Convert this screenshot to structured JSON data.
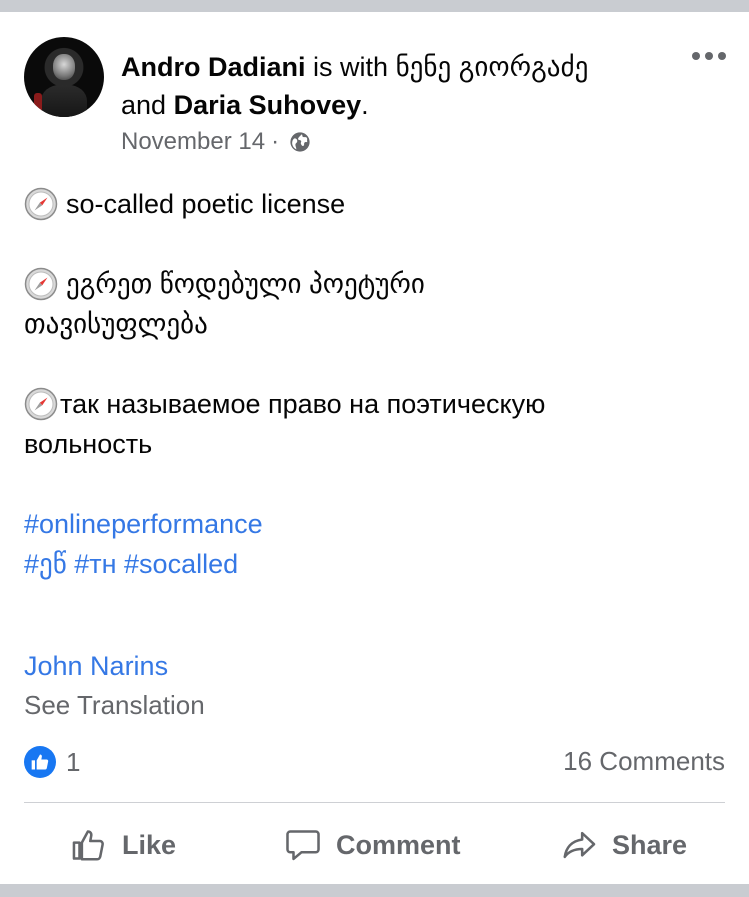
{
  "post": {
    "author": "Andro Dadiani",
    "with_text": "is with",
    "tagged_first": "ნენე გიორგაძე",
    "and_text": "and",
    "tagged_second": "Daria  Suhovey",
    "period": ".",
    "date": "November 14",
    "separator": "·",
    "privacy_icon": "globe-icon",
    "lines": {
      "en": "so-called poetic license",
      "ka_1": "ეგრეთ წოდებული პოეტური",
      "ka_2": "თავისუფლება",
      "ru_1": "так называемое право на поэтическую",
      "ru_2": "вольность"
    },
    "hashtags": {
      "h1": "#onlineperformance",
      "h2": "#ეწ",
      "h3": "#тн",
      "h4": "#socalled"
    },
    "tagged_name": "John Narins",
    "see_translation": "See Translation"
  },
  "reactions": {
    "icon": "thumbs-up-icon",
    "count": "1",
    "comments": "16 Comments"
  },
  "actions": {
    "like": "Like",
    "comment": "Comment",
    "share": "Share"
  },
  "colors": {
    "link": "#3578e5",
    "meta": "#65676b",
    "facebook_blue": "#1877f2",
    "band": "#c9ccd1"
  }
}
